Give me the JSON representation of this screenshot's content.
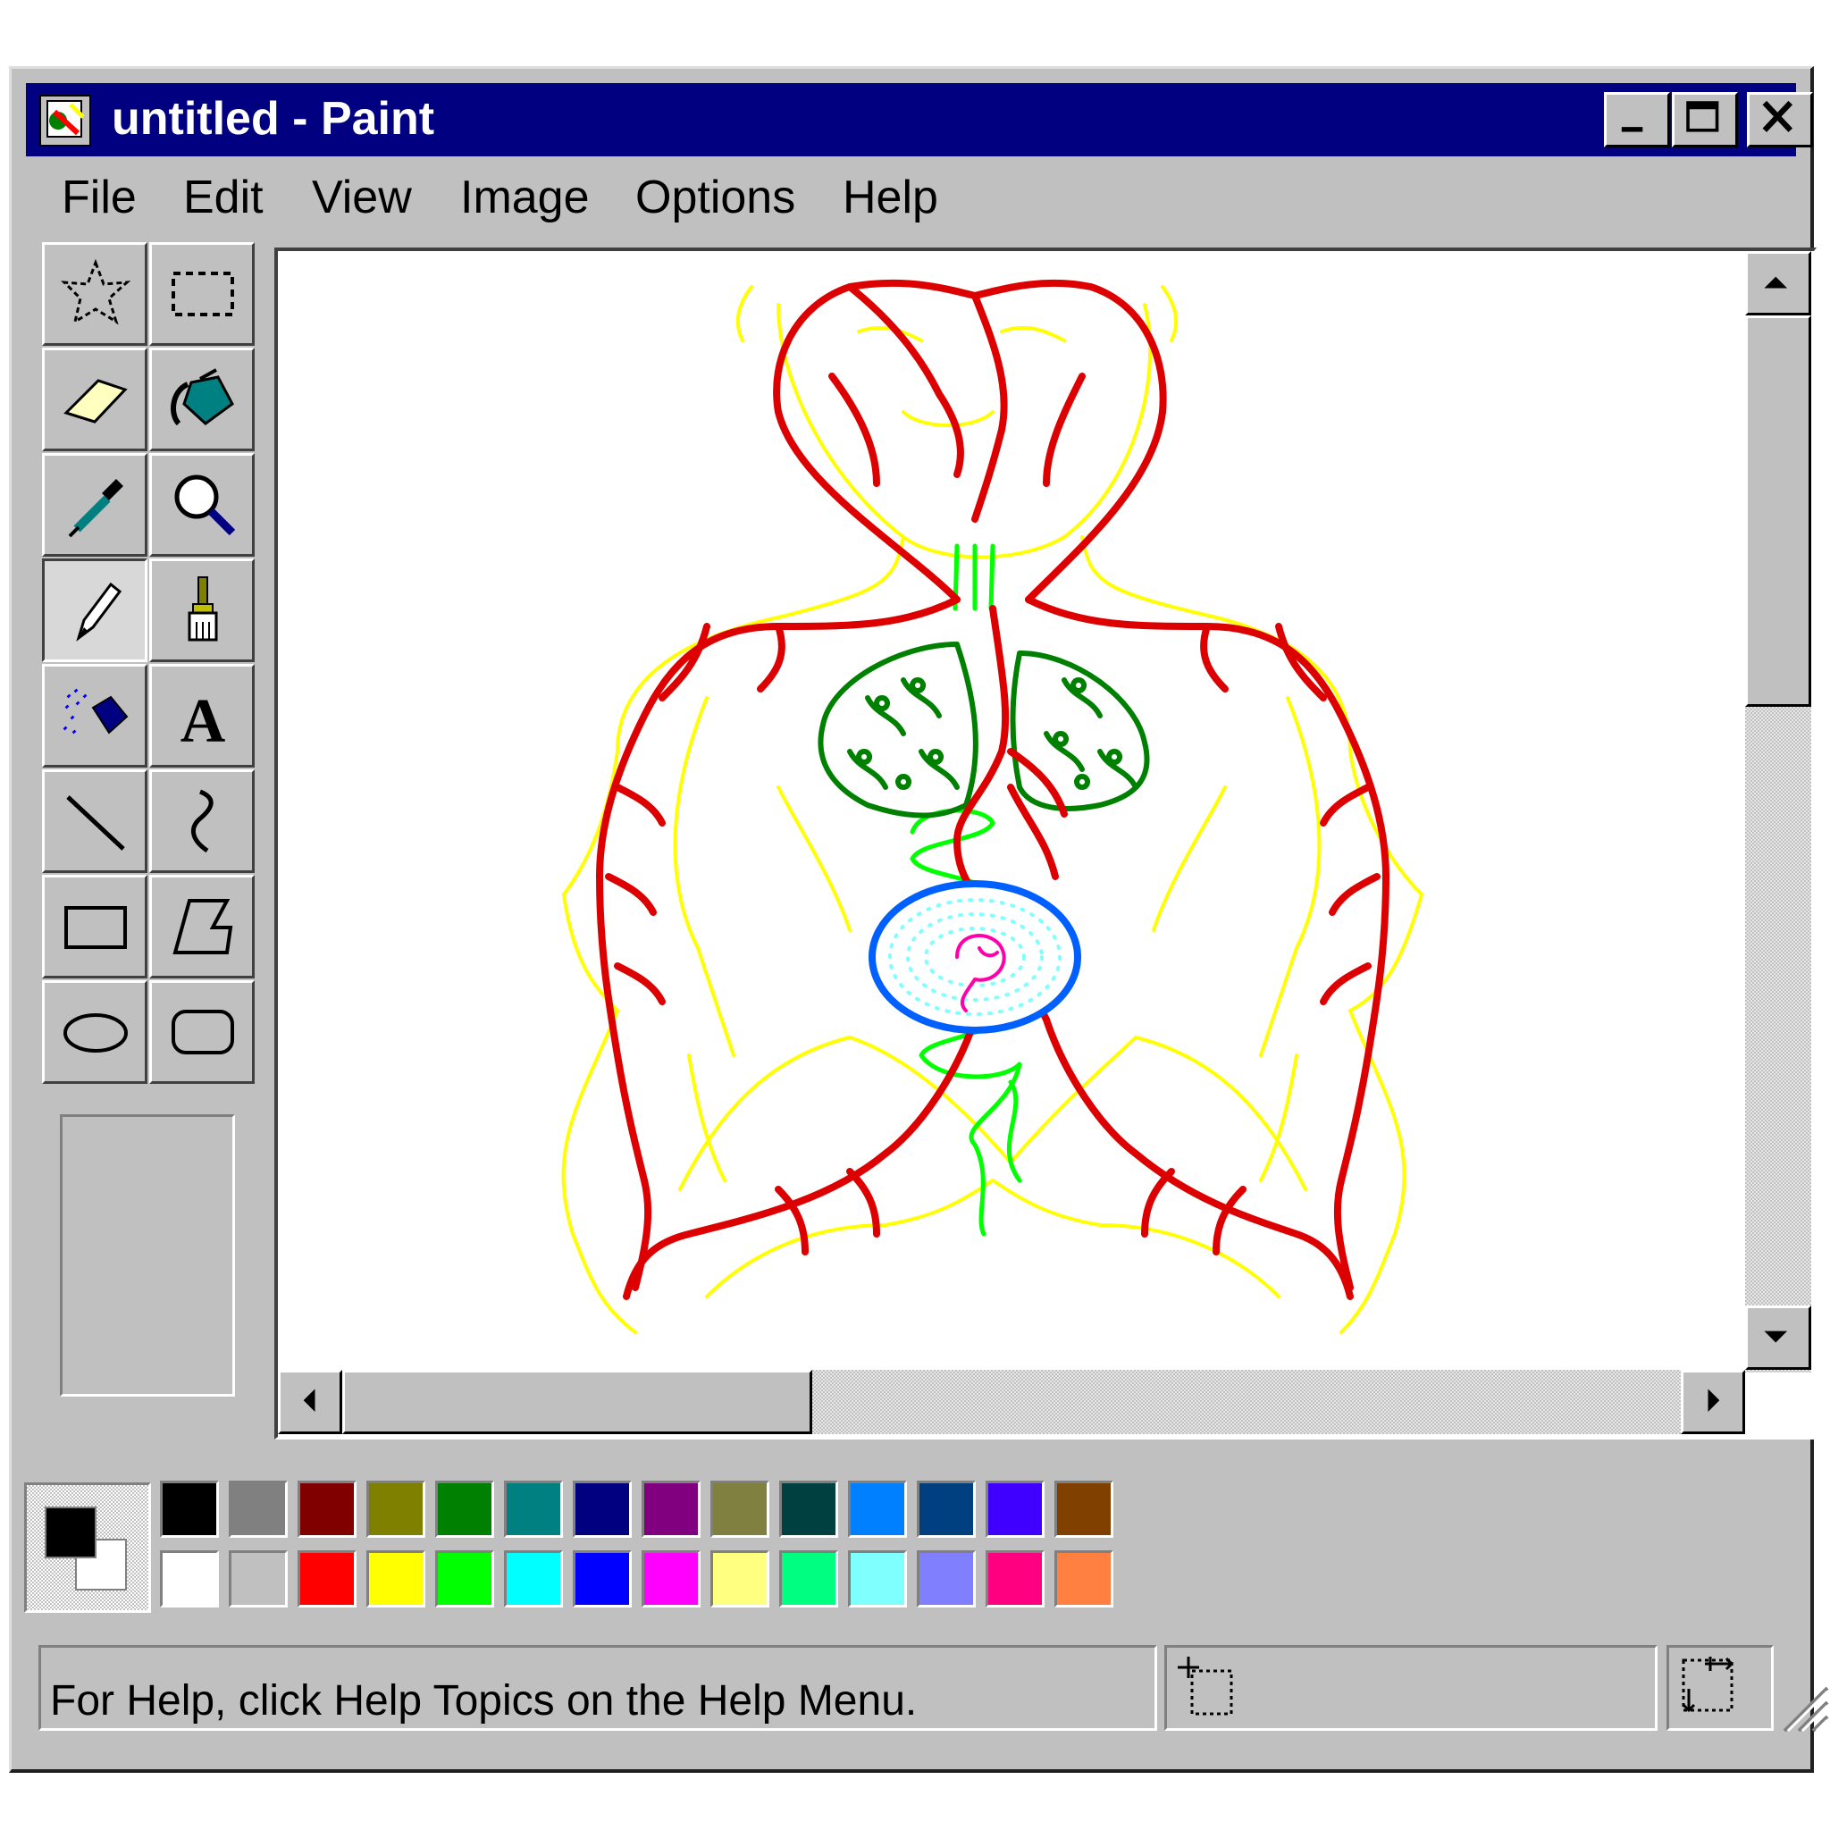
{
  "window": {
    "title": "untitled - Paint",
    "title_bar_color": "#000080",
    "controls": [
      "minimize-icon",
      "maximize-icon",
      "close-icon"
    ]
  },
  "menu": [
    {
      "label": "File"
    },
    {
      "label": "Edit"
    },
    {
      "label": "View"
    },
    {
      "label": "Image"
    },
    {
      "label": "Options"
    },
    {
      "label": "Help"
    }
  ],
  "tools": [
    {
      "name": "free-form-select",
      "icon": "free-form-select-icon"
    },
    {
      "name": "select",
      "icon": "rectangle-select-icon"
    },
    {
      "name": "eraser",
      "icon": "eraser-icon"
    },
    {
      "name": "fill-with-color",
      "icon": "paint-bucket-icon"
    },
    {
      "name": "pick-color",
      "icon": "eyedropper-icon"
    },
    {
      "name": "magnifier",
      "icon": "magnifier-icon"
    },
    {
      "name": "pencil",
      "icon": "pencil-icon",
      "selected": true
    },
    {
      "name": "brush",
      "icon": "brush-icon"
    },
    {
      "name": "airbrush",
      "icon": "airbrush-icon"
    },
    {
      "name": "text",
      "icon": "text-icon",
      "glyph": "A"
    },
    {
      "name": "line",
      "icon": "line-icon"
    },
    {
      "name": "curve",
      "icon": "curve-icon"
    },
    {
      "name": "rectangle",
      "icon": "rectangle-icon"
    },
    {
      "name": "polygon",
      "icon": "polygon-icon"
    },
    {
      "name": "ellipse",
      "icon": "ellipse-icon"
    },
    {
      "name": "rounded-rectangle",
      "icon": "rounded-rectangle-icon"
    }
  ],
  "colors": {
    "foreground": "#000000",
    "background": "#ffffff",
    "palette_top": [
      "#000000",
      "#808080",
      "#800000",
      "#808000",
      "#008000",
      "#008080",
      "#000080",
      "#800080",
      "#808040",
      "#004040",
      "#0080ff",
      "#004080",
      "#4000ff",
      "#804000"
    ],
    "palette_bottom": [
      "#ffffff",
      "#c0c0c0",
      "#ff0000",
      "#ffff00",
      "#00ff00",
      "#00ffff",
      "#0000ff",
      "#ff00ff",
      "#ffff80",
      "#00ff80",
      "#80ffff",
      "#8080ff",
      "#ff0080",
      "#ff8040"
    ]
  },
  "status": {
    "help_text": "For Help, click Help Topics on the Help Menu."
  }
}
